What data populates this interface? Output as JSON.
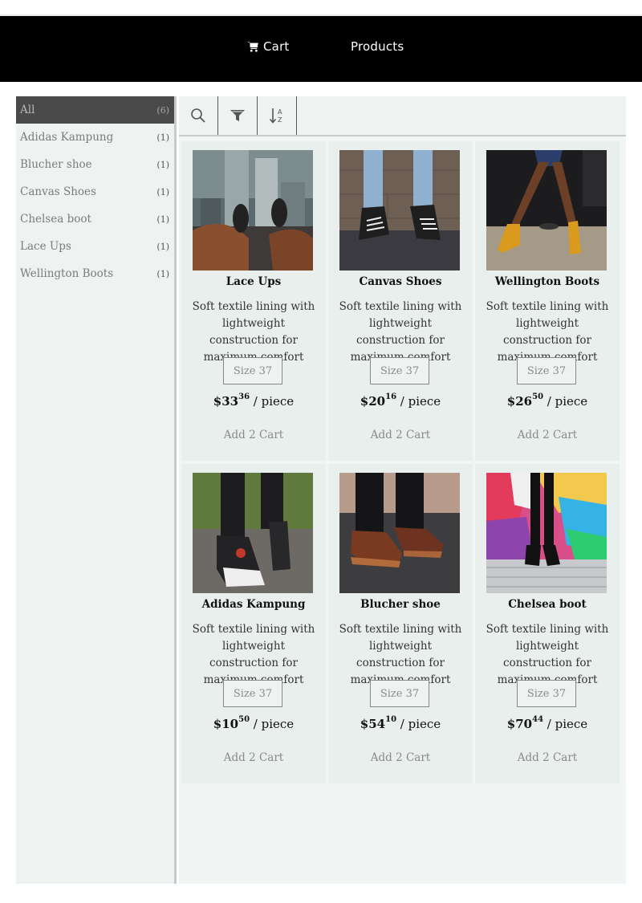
{
  "nav": {
    "cart_label": "Cart",
    "products_label": "Products"
  },
  "sidebar": {
    "items": [
      {
        "label": "All",
        "count": "(6)"
      },
      {
        "label": "Adidas Kampung",
        "count": "(1)"
      },
      {
        "label": "Blucher shoe",
        "count": "(1)"
      },
      {
        "label": "Canvas Shoes",
        "count": "(1)"
      },
      {
        "label": "Chelsea boot",
        "count": "(1)"
      },
      {
        "label": "Lace Ups",
        "count": "(1)"
      },
      {
        "label": "Wellington Boots",
        "count": "(1)"
      }
    ]
  },
  "toolbar": {
    "icons": [
      "search-icon",
      "filter-icon",
      "sort-alpha-icon"
    ]
  },
  "products": [
    {
      "name": "Lace Ups",
      "desc": "Soft textile lining with lightweight construction for maximum comfort",
      "size": "Size 37",
      "dollars": "$33",
      "cents": "36",
      "unit": " / piece",
      "add_label": "Add 2 Cart"
    },
    {
      "name": "Canvas Shoes",
      "desc": "Soft textile lining with lightweight construction for maximum comfort",
      "size": "Size 37",
      "dollars": "$20",
      "cents": "16",
      "unit": " / piece",
      "add_label": "Add 2 Cart"
    },
    {
      "name": "Wellington Boots",
      "desc": "Soft textile lining with lightweight construction for maximum comfort",
      "size": "Size 37",
      "dollars": "$26",
      "cents": "50",
      "unit": " / piece",
      "add_label": "Add 2 Cart"
    },
    {
      "name": "Adidas Kampung",
      "desc": "Soft textile lining with lightweight construction for maximum comfort",
      "size": "Size 37",
      "dollars": "$10",
      "cents": "50",
      "unit": " / piece",
      "add_label": "Add 2 Cart"
    },
    {
      "name": "Blucher shoe",
      "desc": "Soft textile lining with lightweight construction for maximum comfort",
      "size": "Size 37",
      "dollars": "$54",
      "cents": "10",
      "unit": " / piece",
      "add_label": "Add 2 Cart"
    },
    {
      "name": "Chelsea boot",
      "desc": "Soft textile lining with lightweight construction for maximum comfort",
      "size": "Size 37",
      "dollars": "$70",
      "cents": "44",
      "unit": " / piece",
      "add_label": "Add 2 Cart"
    }
  ],
  "colors": {
    "navbar": "#000000",
    "sidebar_active": "#4a4a4a",
    "panel": "#eef3f1"
  }
}
